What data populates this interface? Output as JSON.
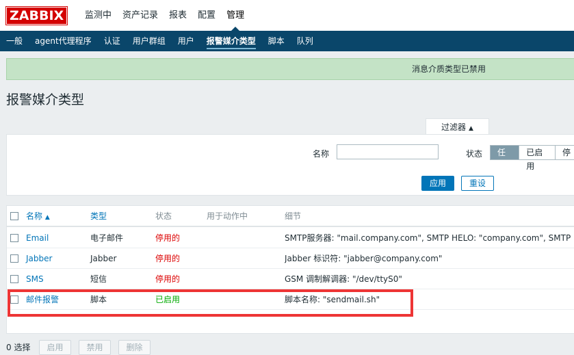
{
  "logo": "ZABBIX",
  "topnav": [
    "监测中",
    "资产记录",
    "报表",
    "配置",
    "管理"
  ],
  "subnav": [
    "一般",
    "agent代理程序",
    "认证",
    "用户群组",
    "用户",
    "报警媒介类型",
    "脚本",
    "队列"
  ],
  "message": "消息介质类型已禁用",
  "page_title": "报警媒介类型",
  "filter": {
    "tab_label": "过滤器",
    "name_label": "名称",
    "name_value": "",
    "status_label": "状态",
    "status_options": [
      "任何",
      "已启用",
      "停"
    ],
    "apply": "应用",
    "reset": "重设"
  },
  "table": {
    "headers": {
      "name": "名称",
      "sort_arrow": "▲",
      "type": "类型",
      "status": "状态",
      "used": "用于动作中",
      "details": "细节"
    },
    "rows": [
      {
        "name": "Email",
        "type": "电子邮件",
        "status": "停用的",
        "used": "",
        "details": "SMTP服务器: \"mail.company.com\", SMTP HELO: \"company.com\", SMTP电邮: \"zabbix@company.com\""
      },
      {
        "name": "Jabber",
        "type": "Jabber",
        "status": "停用的",
        "used": "",
        "details": "Jabber 标识符: \"jabber@company.com\""
      },
      {
        "name": "SMS",
        "type": "短信",
        "status": "停用的",
        "used": "",
        "details": "GSM 调制解调器: \"/dev/ttyS0\""
      },
      {
        "name": "邮件报警",
        "type": "脚本",
        "status": "已启用",
        "used": "",
        "details": "脚本名称: \"sendmail.sh\""
      }
    ]
  },
  "footer": {
    "selected": "0 选择",
    "buttons": [
      "启用",
      "禁用",
      "删除"
    ]
  },
  "colors": {
    "nav_bg": "#0a466a",
    "logo_red": "#d40000",
    "link_blue": "#0275b8",
    "disabled_red": "#dc0000",
    "enabled_green": "#00aa00",
    "message_bg": "#c4e3c6",
    "highlight_red": "#ee3535"
  }
}
